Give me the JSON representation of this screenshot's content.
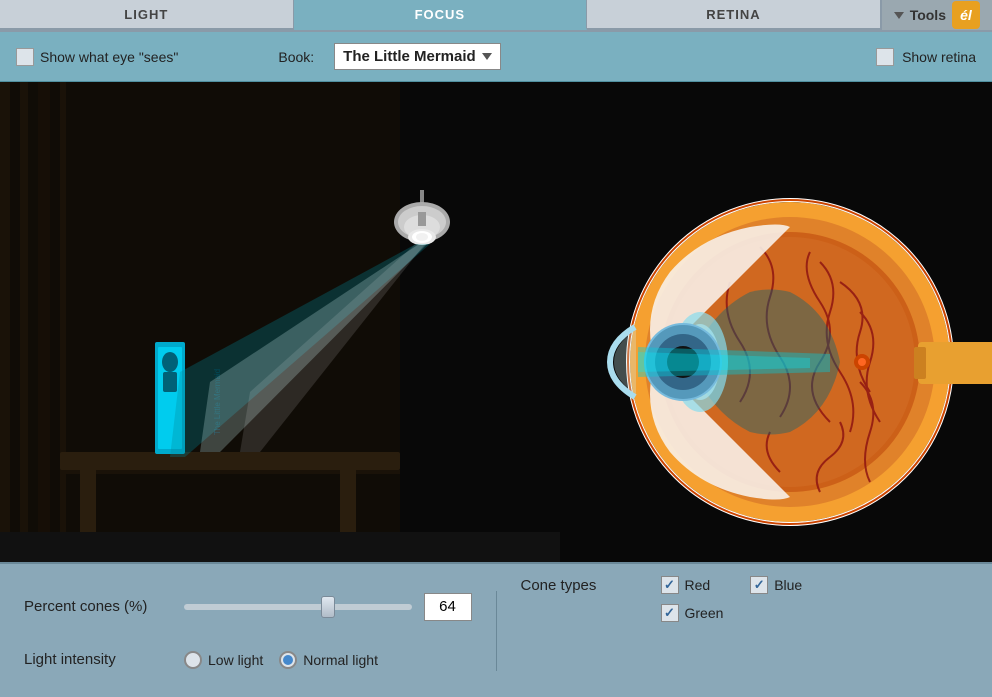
{
  "tabs": [
    {
      "id": "light",
      "label": "LIGHT",
      "active": false
    },
    {
      "id": "focus",
      "label": "FOCUS",
      "active": true
    },
    {
      "id": "retina",
      "label": "RETINA",
      "active": false
    }
  ],
  "tools": {
    "button_label": "Tools",
    "icon_text": "él"
  },
  "controls": {
    "show_what_eye_sees_label": "Show what eye \"sees\"",
    "book_label": "Book:",
    "book_value": "The Little Mermaid",
    "show_retina_label": "Show retina"
  },
  "bottom": {
    "percent_cones_label": "Percent cones (%)",
    "percent_cones_value": "64",
    "light_intensity_label": "Light intensity",
    "low_light_label": "Low light",
    "normal_light_label": "Normal light",
    "cone_types_label": "Cone types",
    "red_label": "Red",
    "blue_label": "Blue",
    "green_label": "Green",
    "red_checked": true,
    "blue_checked": true,
    "green_checked": true
  },
  "colors": {
    "tab_active": "#5a9aac",
    "header_bg": "#7ab0c0",
    "bottom_bg": "#8aa8b8",
    "accent": "#e8a020"
  }
}
